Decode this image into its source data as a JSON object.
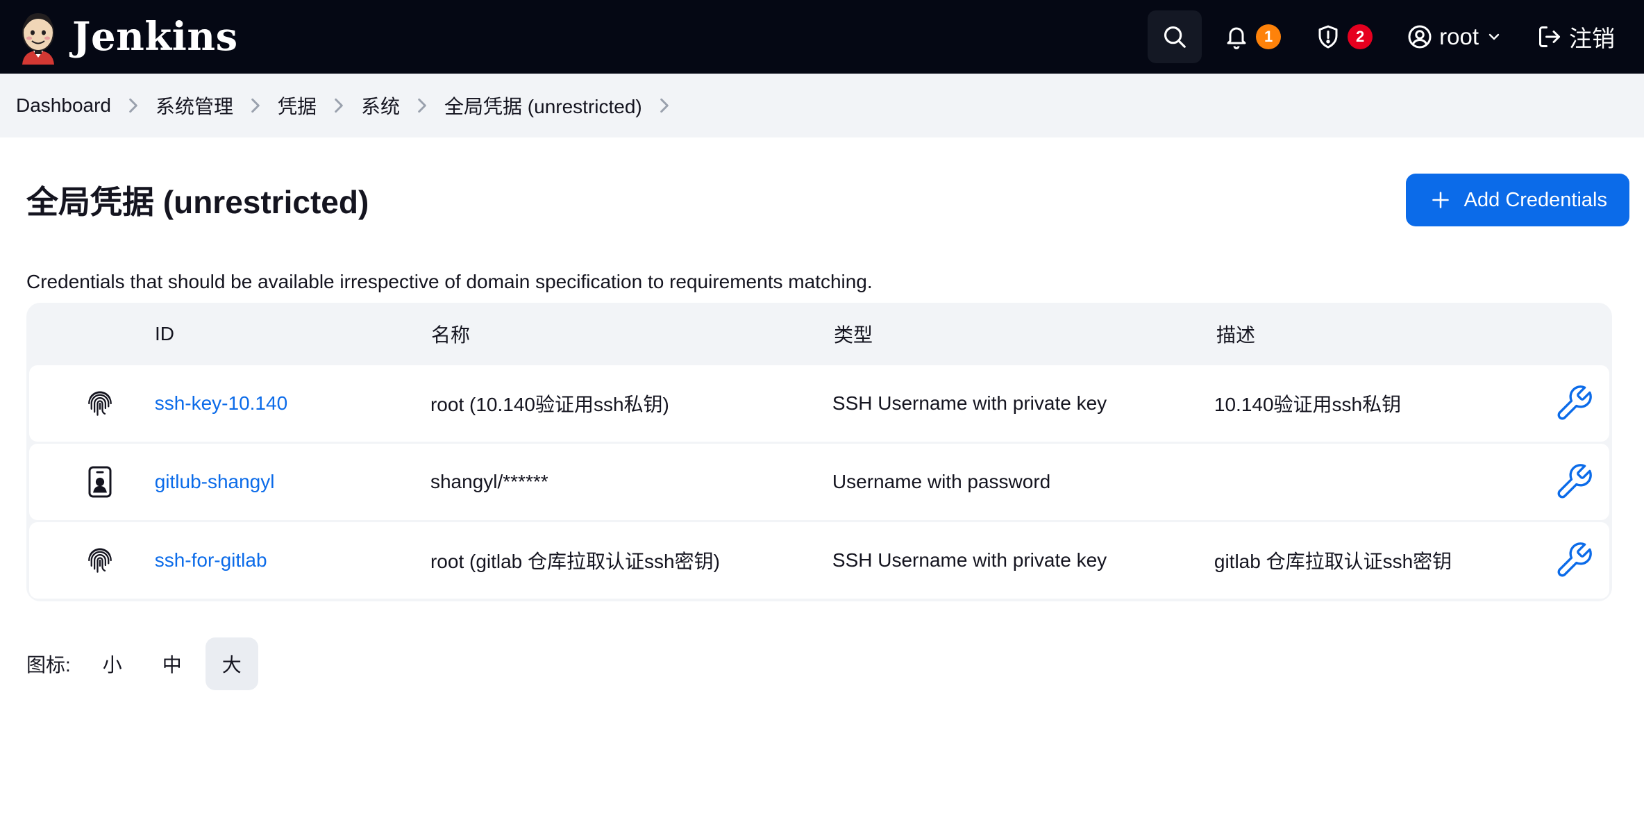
{
  "brand": {
    "name": "Jenkins"
  },
  "header": {
    "notifications_count": "1",
    "security_count": "2",
    "user": "root",
    "logout_label": "注销"
  },
  "breadcrumb": [
    "Dashboard",
    "系统管理",
    "凭据",
    "系统",
    "全局凭据 (unrestricted)"
  ],
  "page": {
    "title": "全局凭据 (unrestricted)",
    "add_button": "Add Credentials",
    "description": "Credentials that should be available irrespective of domain specification to requirements matching."
  },
  "table": {
    "headers": {
      "id": "ID",
      "name": "名称",
      "type": "类型",
      "desc": "描述"
    },
    "rows": [
      {
        "icon": "fingerprint-icon",
        "id": "ssh-key-10.140",
        "name": "root (10.140验证用ssh私钥)",
        "type": "SSH Username with private key",
        "desc": "10.140验证用ssh私钥"
      },
      {
        "icon": "id-badge-icon",
        "id": "gitlub-shangyl",
        "name": "shangyl/******",
        "type": "Username with password",
        "desc": ""
      },
      {
        "icon": "fingerprint-icon",
        "id": "ssh-for-gitlab",
        "name": "root (gitlab 仓库拉取认证ssh密钥)",
        "type": "SSH Username with private key",
        "desc": "gitlab 仓库拉取认证ssh密钥"
      }
    ]
  },
  "icon_size": {
    "label": "图标:",
    "options": [
      "小",
      "中",
      "大"
    ],
    "selected": "大"
  },
  "colors": {
    "header_bg": "#050814",
    "accent": "#0b6be9",
    "badge_orange": "#fe820a",
    "badge_red": "#e6001f"
  }
}
